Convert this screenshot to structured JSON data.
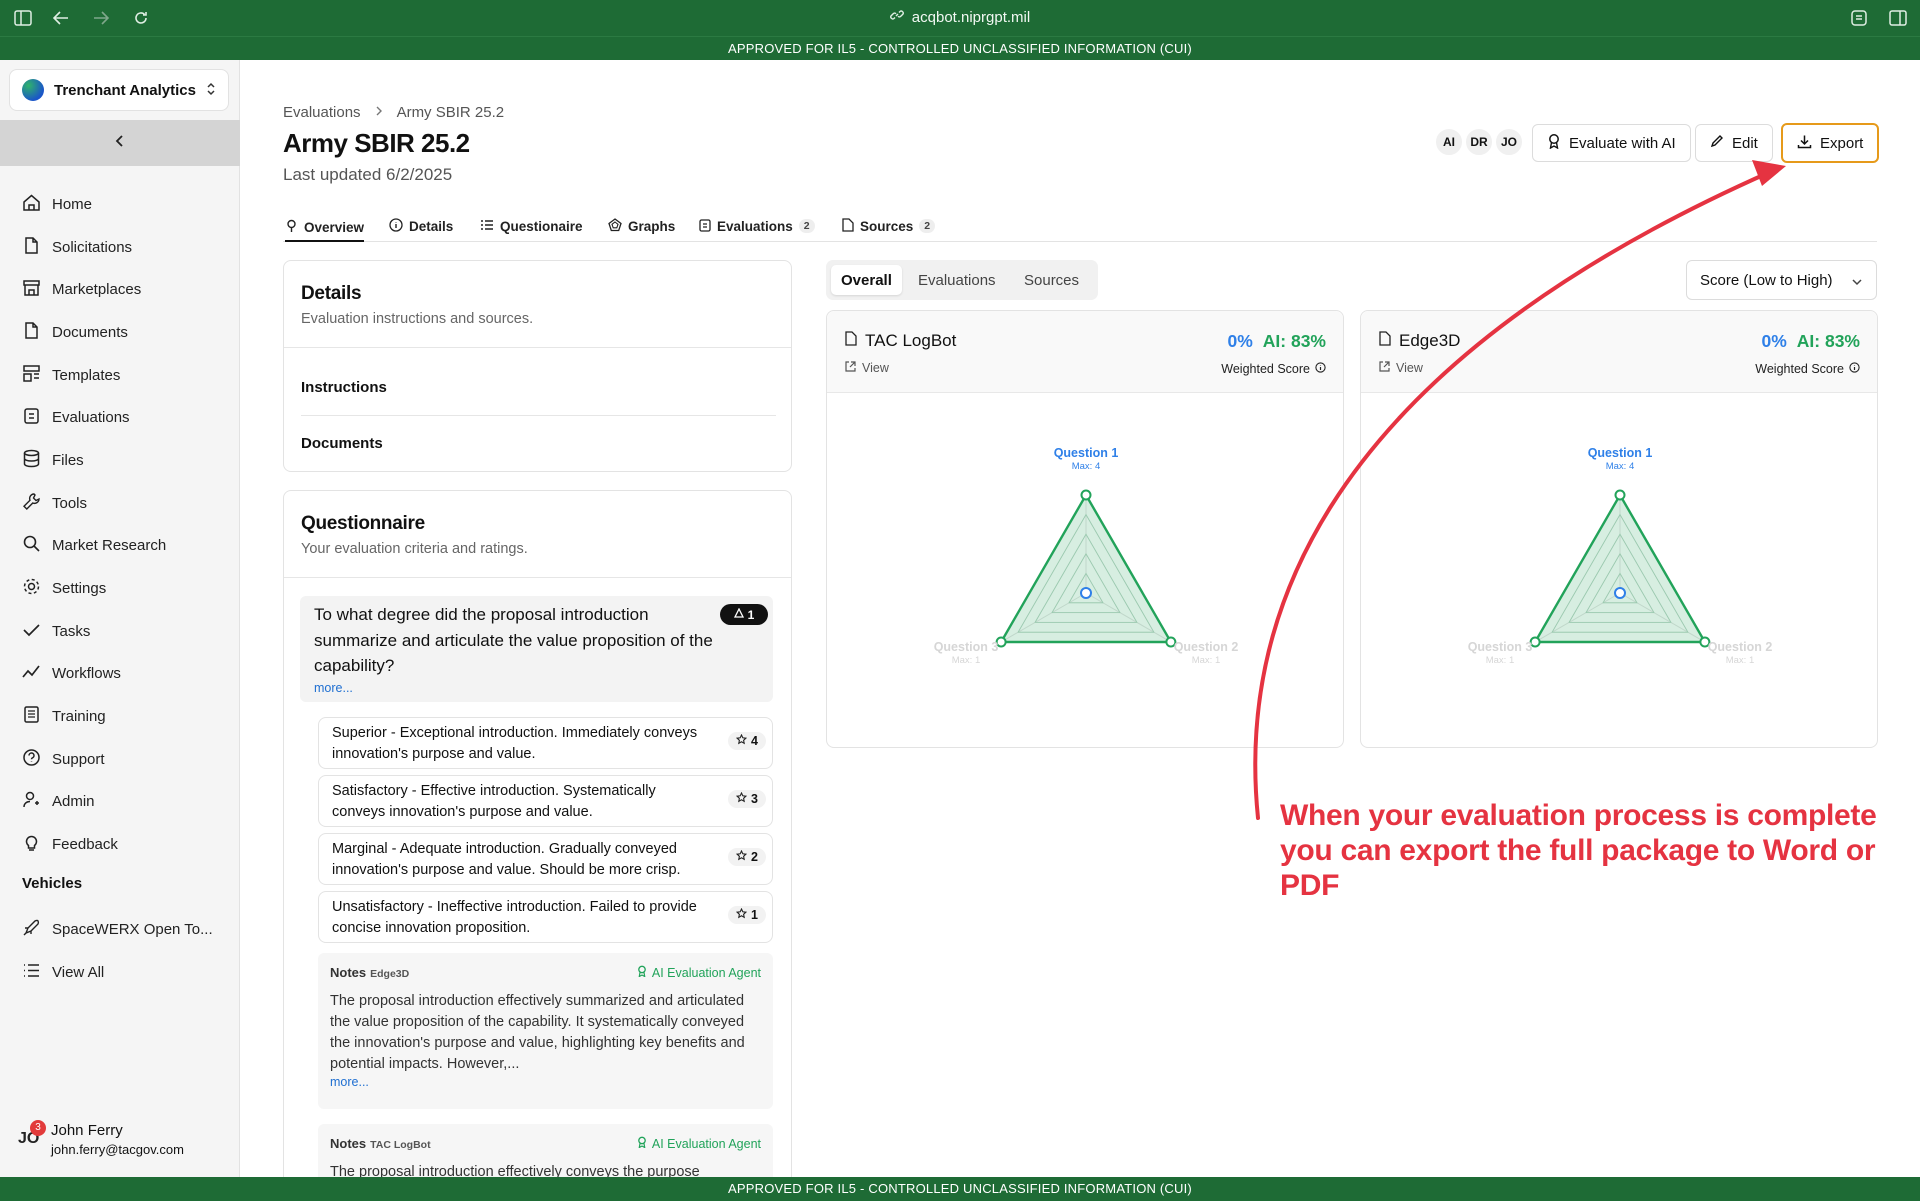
{
  "browser": {
    "url": "acqbot.niprgpt.mil"
  },
  "banner": {
    "top": "APPROVED FOR IL5 - CONTROLLED UNCLASSIFIED INFORMATION (CUI)",
    "bottom": "APPROVED FOR IL5 - CONTROLLED UNCLASSIFIED INFORMATION (CUI)"
  },
  "sidebar": {
    "org_name": "Trenchant Analytics",
    "items": [
      {
        "label": "Home",
        "icon": "home-icon"
      },
      {
        "label": "Solicitations",
        "icon": "file-icon"
      },
      {
        "label": "Marketplaces",
        "icon": "store-icon"
      },
      {
        "label": "Documents",
        "icon": "file-icon"
      },
      {
        "label": "Templates",
        "icon": "templates-icon"
      },
      {
        "label": "Evaluations",
        "icon": "clipboard-icon"
      },
      {
        "label": "Files",
        "icon": "database-icon"
      },
      {
        "label": "Tools",
        "icon": "wrench-icon"
      },
      {
        "label": "Market Research",
        "icon": "search-icon"
      },
      {
        "label": "Settings",
        "icon": "gear-icon"
      },
      {
        "label": "Tasks",
        "icon": "check-icon"
      },
      {
        "label": "Workflows",
        "icon": "trend-icon"
      },
      {
        "label": "Training",
        "icon": "book-icon"
      },
      {
        "label": "Support",
        "icon": "help-icon"
      },
      {
        "label": "Admin",
        "icon": "user-cog-icon"
      },
      {
        "label": "Feedback",
        "icon": "bulb-icon"
      }
    ],
    "vehicles_title": "Vehicles",
    "vehicles": [
      {
        "label": "SpaceWERX Open To...",
        "icon": "rocket-icon"
      },
      {
        "label": "View All",
        "icon": "list-icon"
      }
    ],
    "user": {
      "initials": "JO",
      "badge": "3",
      "name": "John Ferry",
      "email": "john.ferry@tacgov.com"
    }
  },
  "header": {
    "breadcrumb": [
      "Evaluations",
      "Army SBIR 25.2"
    ],
    "title": "Army SBIR 25.2",
    "updated": "Last updated 6/2/2025",
    "avatars": [
      "AI",
      "DR",
      "JO"
    ],
    "buttons": {
      "evaluate": "Evaluate with AI",
      "edit": "Edit",
      "export": "Export"
    }
  },
  "tabs": [
    {
      "label": "Overview",
      "count": null
    },
    {
      "label": "Details",
      "count": null
    },
    {
      "label": "Questionaire",
      "count": null
    },
    {
      "label": "Graphs",
      "count": null
    },
    {
      "label": "Evaluations",
      "count": "2"
    },
    {
      "label": "Sources",
      "count": "2"
    }
  ],
  "details_card": {
    "title": "Details",
    "subtitle": "Evaluation instructions and sources.",
    "rows": [
      "Instructions",
      "Documents"
    ]
  },
  "questionnaire": {
    "title": "Questionnaire",
    "subtitle": "Your evaluation criteria and ratings.",
    "question": "To what degree did the proposal introduction summarize and articulate the value proposition of the capability?",
    "more": "more...",
    "badge": "1",
    "options": [
      {
        "text": "Superior - Exceptional introduction. Immediately conveys innovation's purpose and value.",
        "score": "4"
      },
      {
        "text": "Satisfactory - Effective introduction. Systematically conveys innovation's purpose and value.",
        "score": "3"
      },
      {
        "text": "Marginal - Adequate introduction. Gradually conveyed innovation's purpose and value. Should be more crisp.",
        "score": "2"
      },
      {
        "text": "Unsatisfactory - Ineffective introduction. Failed to provide concise innovation proposition.",
        "score": "1"
      }
    ],
    "notes": [
      {
        "label": "Notes",
        "source": "Edge3D",
        "agent": "AI Evaluation Agent",
        "text": "The proposal introduction effectively summarized and articulated the value proposition of the capability. It systematically conveyed the innovation's purpose and value, highlighting key benefits and potential impacts. However,...",
        "more": "more..."
      },
      {
        "label": "Notes",
        "source": "TAC LogBot",
        "agent": "AI Evaluation Agent",
        "text": "The proposal introduction effectively conveys the purpose",
        "more": ""
      }
    ]
  },
  "overview": {
    "segments": [
      "Overall",
      "Evaluations",
      "Sources"
    ],
    "sort": "Score (Low to High)",
    "cards": [
      {
        "name": "TAC LogBot",
        "view": "View",
        "score": "0%",
        "ai": "AI: 83%",
        "weighted": "Weighted Score"
      },
      {
        "name": "Edge3D",
        "view": "View",
        "score": "0%",
        "ai": "AI: 83%",
        "weighted": "Weighted Score"
      }
    ]
  },
  "chart_data": [
    {
      "type": "radar",
      "title": "TAC LogBot",
      "axes": [
        "Question 1",
        "Question 2",
        "Question 3"
      ],
      "axis_max_labels": [
        "Max: 4",
        "Max: 1",
        "Max: 1"
      ],
      "max": [
        4,
        1,
        1
      ],
      "series": [
        {
          "name": "",
          "values": [
            1.0,
            1.0,
            1.0
          ],
          "color": "#22a35a"
        },
        {
          "name": "",
          "values": [
            0,
            0,
            0
          ],
          "color": "#2f80e8"
        }
      ]
    },
    {
      "type": "radar",
      "title": "Edge3D",
      "axes": [
        "Question 1",
        "Question 2",
        "Question 3"
      ],
      "axis_max_labels": [
        "Max: 4",
        "Max: 1",
        "Max: 1"
      ],
      "max": [
        4,
        1,
        1
      ],
      "series": [
        {
          "name": "",
          "values": [
            1.0,
            1.0,
            1.0
          ],
          "color": "#22a35a"
        },
        {
          "name": "",
          "values": [
            0,
            0,
            0
          ],
          "color": "#2f80e8"
        }
      ]
    }
  ],
  "annotation": "When your evaluation process is complete you can export the full package to Word or PDF",
  "colors": {
    "brand_green": "#1e6b35",
    "ai_green": "#22a35a",
    "score_blue": "#2f80e8",
    "annotation_red": "#e53341",
    "export_border": "#e69a1a"
  }
}
